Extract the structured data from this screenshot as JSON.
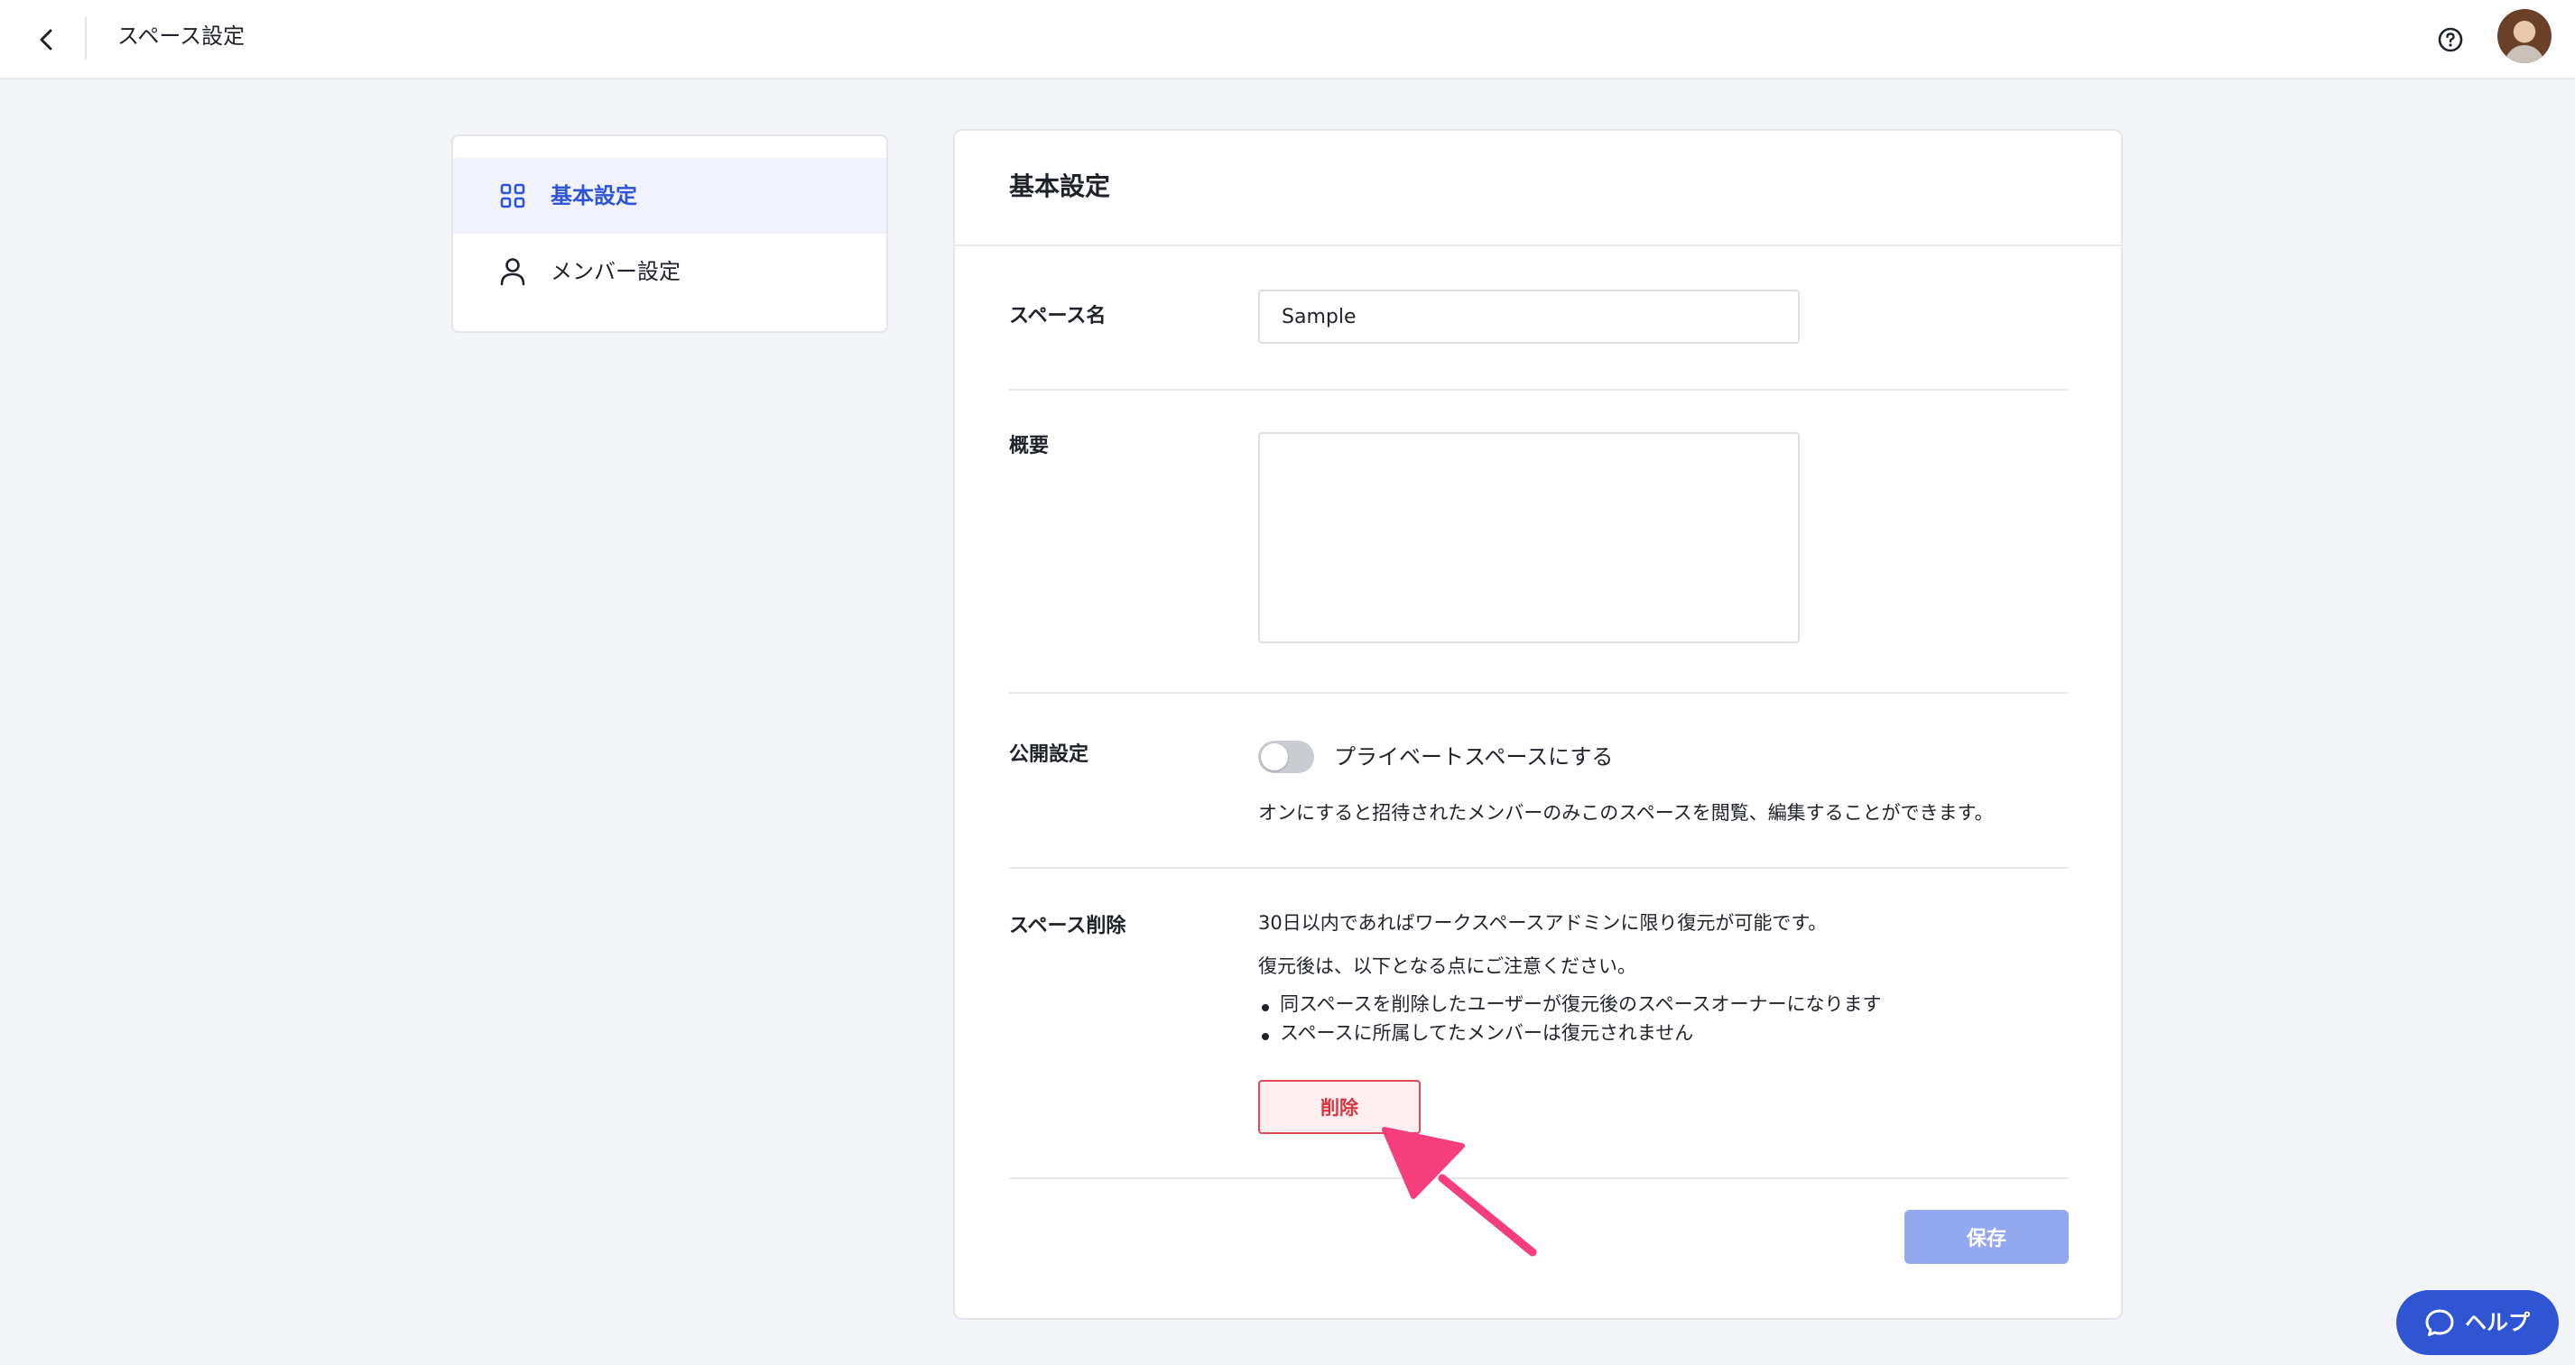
{
  "header": {
    "title": "スペース設定",
    "back_icon": "chevron-left-icon",
    "help_icon": "question-circle-icon",
    "avatar": "user-avatar"
  },
  "sidebar": {
    "items": [
      {
        "label": "基本設定",
        "icon": "grid-icon",
        "active": true
      },
      {
        "label": "メンバー設定",
        "icon": "person-icon",
        "active": false
      }
    ]
  },
  "main": {
    "title": "基本設定",
    "space_name": {
      "label": "スペース名",
      "value": "Sample",
      "placeholder": ""
    },
    "overview": {
      "label": "概要",
      "value": "",
      "placeholder": ""
    },
    "visibility": {
      "label": "公開設定",
      "toggle_label": "プライベートスペースにする",
      "toggle_on": false,
      "description": "オンにすると招待されたメンバーのみこのスペースを閲覧、編集することができます。"
    },
    "deletion": {
      "label": "スペース削除",
      "line1": "30日以内であればワークスペースアドミンに限り復元が可能です。",
      "line2": "復元後は、以下となる点にご注意ください。",
      "bullets": [
        "同スペースを削除したユーザーが復元後のスペースオーナーになります",
        "スペースに所属してたメンバーは復元されません"
      ],
      "button_label": "削除"
    },
    "save_label": "保存"
  },
  "help_fab": {
    "label": "ヘルプ",
    "icon": "chat-bubble-icon"
  },
  "colors": {
    "accent": "#2f55d4",
    "danger": "#d93440",
    "annotation": "#f73e7c",
    "save_disabled": "#94a8f2"
  }
}
